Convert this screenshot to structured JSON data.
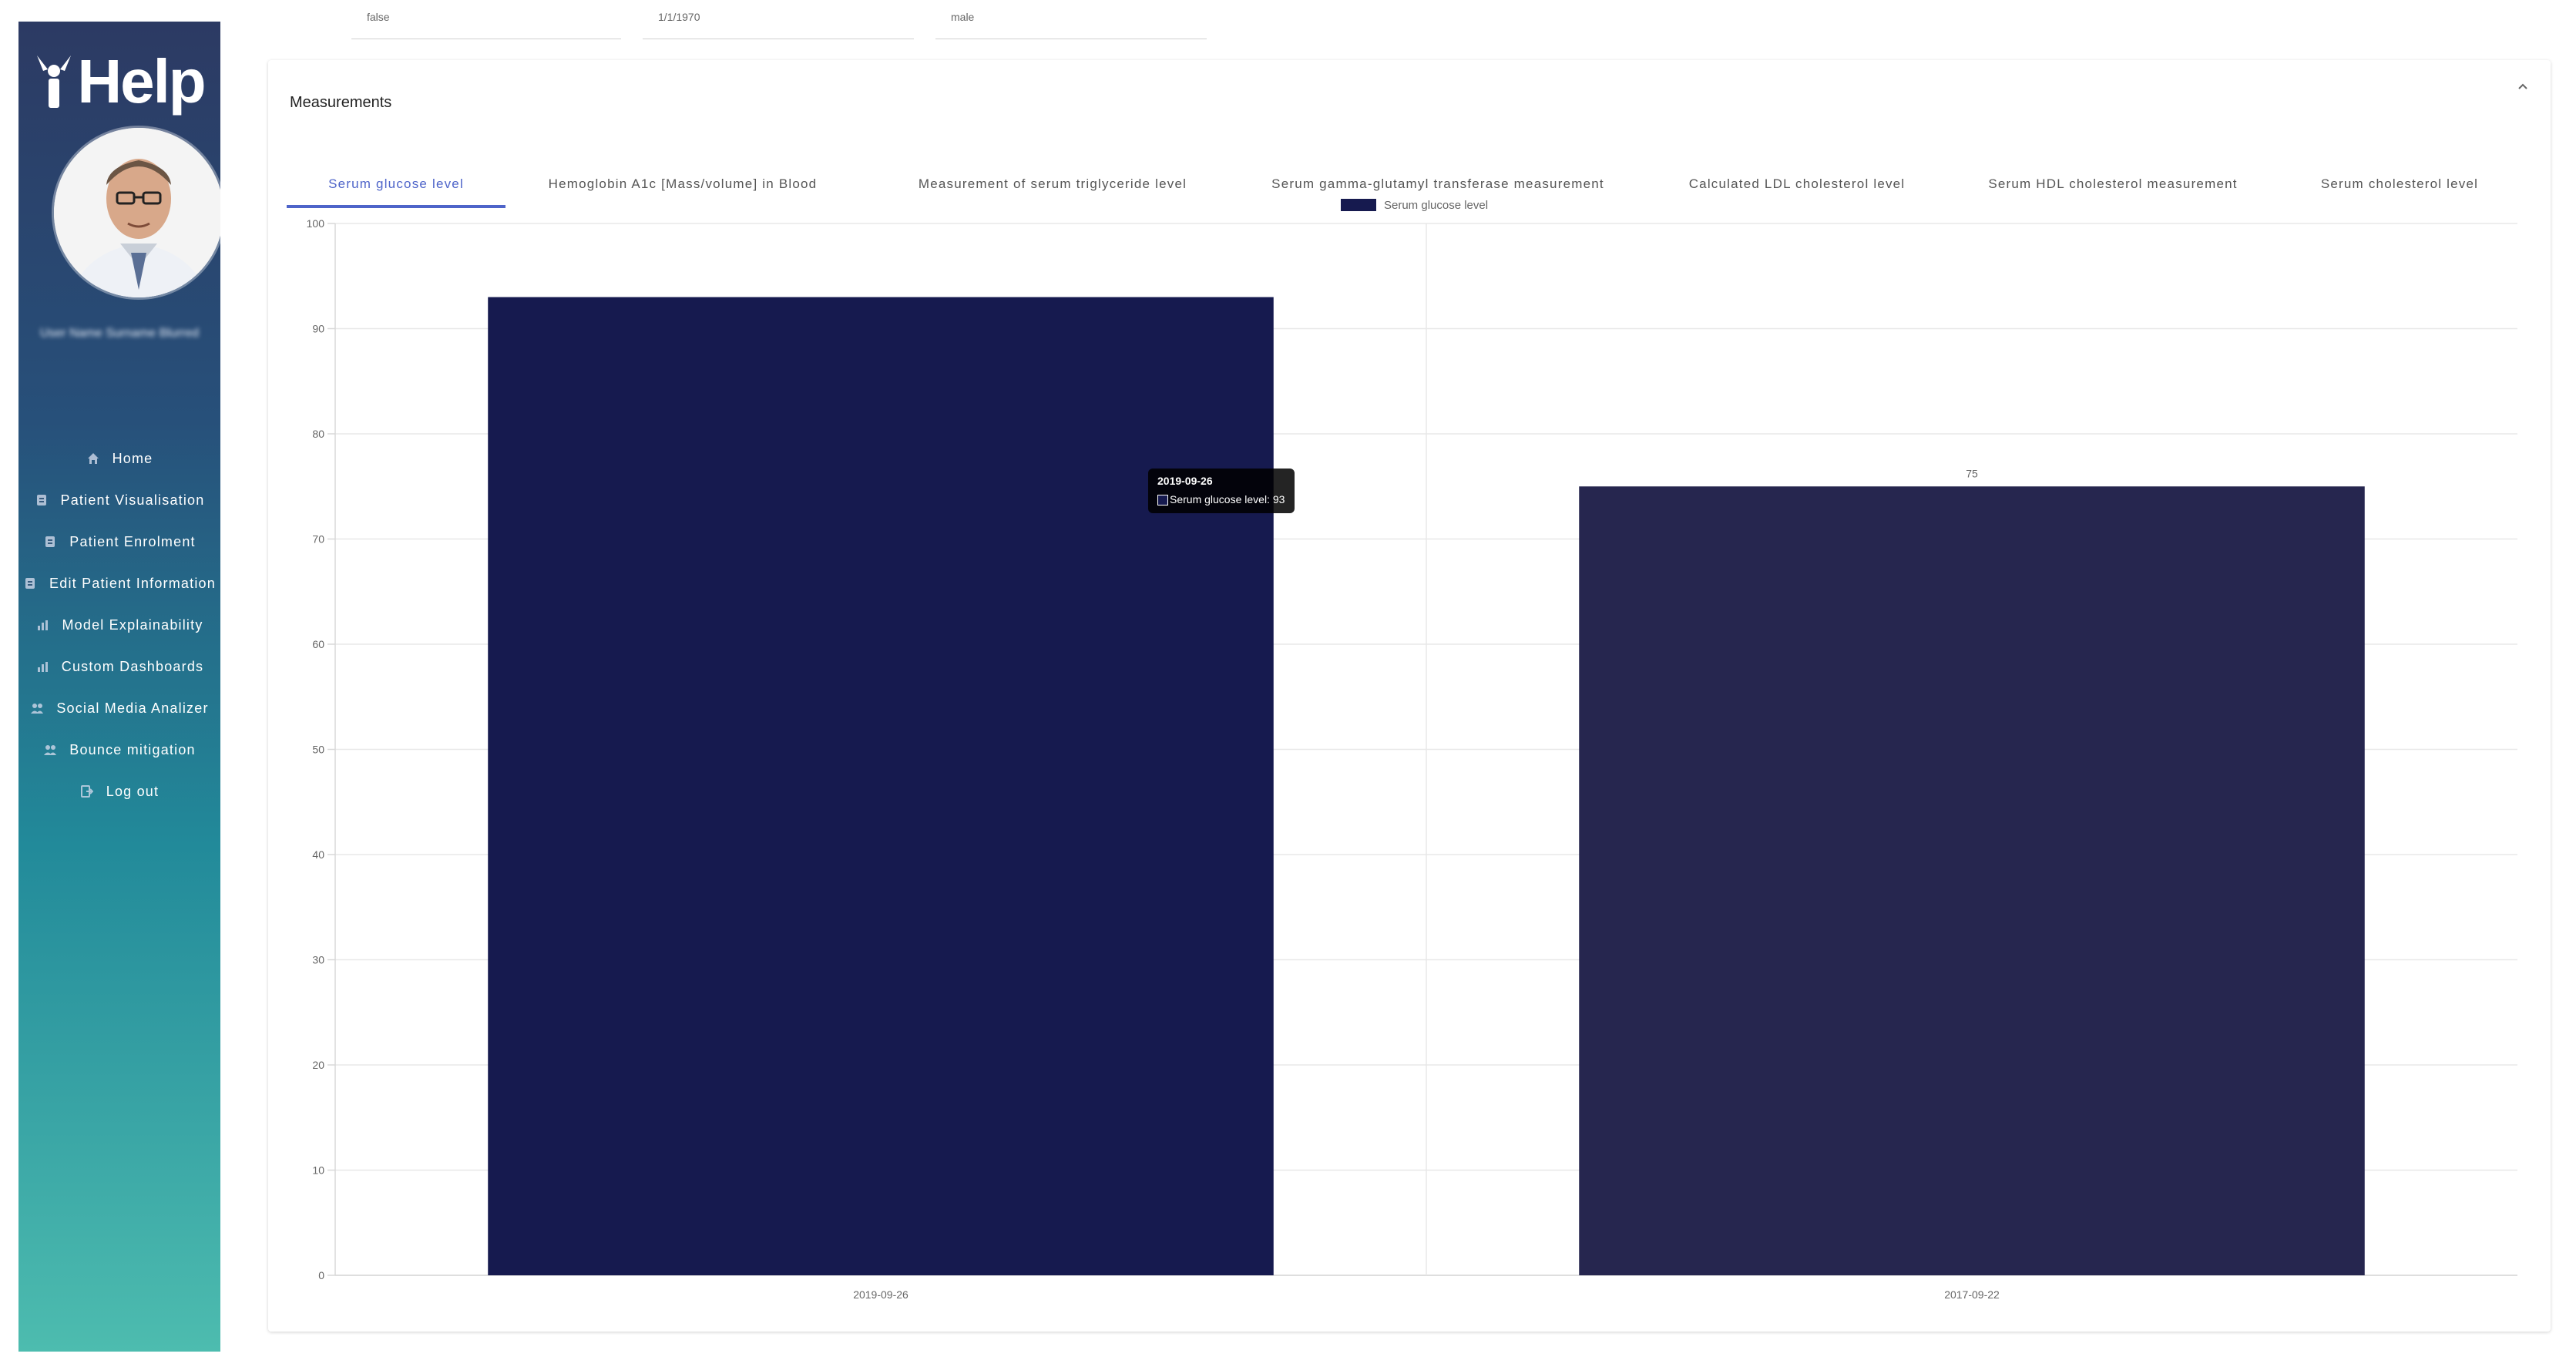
{
  "app": {
    "logo_text": "Help"
  },
  "sidebar": {
    "user_name": "User Name Surname Blurred",
    "items": [
      {
        "label": "Home",
        "icon": "home-icon"
      },
      {
        "label": "Patient Visualisation",
        "icon": "document-icon"
      },
      {
        "label": "Patient Enrolment",
        "icon": "document-icon"
      },
      {
        "label": "Edit Patient Information",
        "icon": "document-icon"
      },
      {
        "label": "Model Explainability",
        "icon": "chart-icon"
      },
      {
        "label": "Custom Dashboards",
        "icon": "chart-icon"
      },
      {
        "label": "Social Media Analizer",
        "icon": "people-icon"
      },
      {
        "label": "Bounce mitigation",
        "icon": "people-icon"
      },
      {
        "label": "Log out",
        "icon": "logout-icon"
      }
    ]
  },
  "prev_card": {
    "fields": [
      "false",
      "1/1/1970",
      "male"
    ]
  },
  "measurements": {
    "title": "Measurements",
    "tabs": [
      "Serum glucose level",
      "Hemoglobin A1c [Mass/volume] in Blood",
      "Measurement of serum triglyceride level",
      "Serum gamma-glutamyl transferase measurement",
      "Calculated LDL cholesterol level",
      "Serum HDL cholesterol measurement",
      "Serum cholesterol level"
    ],
    "active_tab": 0
  },
  "tooltip": {
    "title": "2019-09-26",
    "body": "Serum glucose level: 93"
  },
  "chart_data": {
    "type": "bar",
    "categories": [
      "2019-09-26",
      "2017-09-22"
    ],
    "series": [
      {
        "name": "Serum glucose level",
        "values": [
          93,
          75
        ],
        "colors": [
          "#161a4f",
          "#26264f"
        ]
      }
    ],
    "ylim": [
      0,
      100
    ],
    "yticks": [
      0,
      10,
      20,
      30,
      40,
      50,
      60,
      70,
      80,
      90,
      100
    ],
    "data_labels": [
      "",
      "75"
    ],
    "grid": true,
    "legend": "top-center",
    "title": "",
    "xlabel": "",
    "ylabel": ""
  }
}
